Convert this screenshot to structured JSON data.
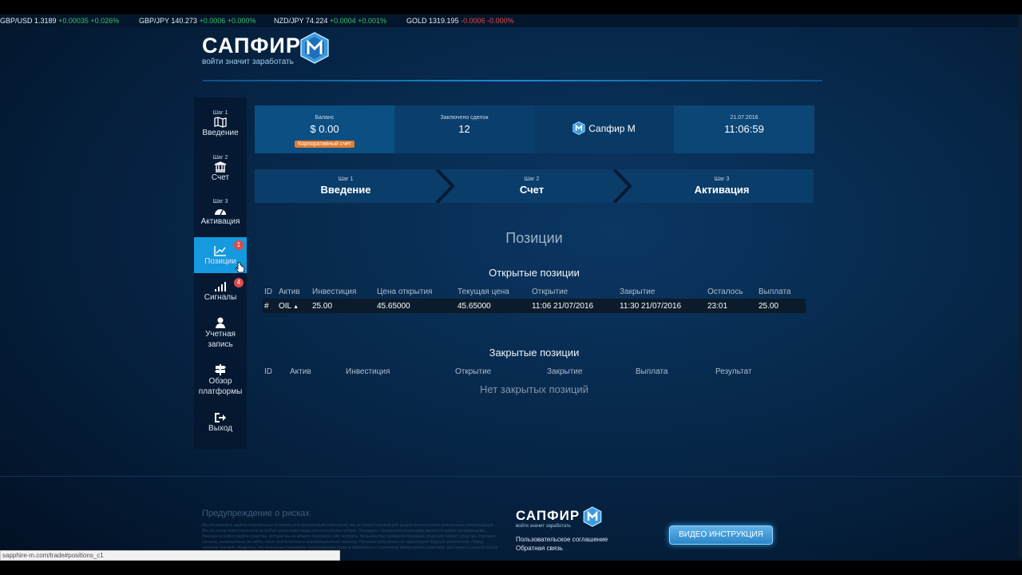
{
  "ticker": [
    {
      "symbol": "GBP/USD",
      "price": "1.3189",
      "change": "+0.00035",
      "pct": "+0.026%",
      "dir": "up"
    },
    {
      "symbol": "GBP/JPY",
      "price": "140.273",
      "change": "+0.0006",
      "pct": "+0.000%",
      "dir": "up"
    },
    {
      "symbol": "NZD/JPY",
      "price": "74.224",
      "change": "+0.0004",
      "pct": "+0.001%",
      "dir": "up"
    },
    {
      "symbol": "GOLD",
      "price": "1319.195",
      "change": "-0.0006",
      "pct": "-0.000%",
      "dir": "down"
    }
  ],
  "logo": {
    "word": "САПФИР",
    "tagline": "войти значит заработать"
  },
  "sidebar": {
    "items": [
      {
        "step": "Шаг 1",
        "label": "Введение",
        "icon": "map-icon"
      },
      {
        "step": "Шаг 2",
        "label": "Счет",
        "icon": "bank-icon"
      },
      {
        "step": "Шаг 3",
        "label": "Активация",
        "icon": "gauge-icon"
      },
      {
        "label": "Позиции",
        "icon": "chart-icon",
        "badge": "1"
      },
      {
        "label": "Сигналы",
        "icon": "signal-icon",
        "badge": "4"
      },
      {
        "label": "Учетная запись",
        "icon": "user-icon"
      },
      {
        "label": "Обзор платформы",
        "icon": "signpost-icon"
      },
      {
        "label": "Выход",
        "icon": "logout-icon"
      }
    ]
  },
  "stats": {
    "balance_label": "Баланс",
    "balance_value": "$ 0.00",
    "account_type": "Корпоративный счет",
    "deals_label": "Заключено сделок",
    "deals_value": "12",
    "brand": "Сапфир М",
    "date": "21.07.2016",
    "time": "11:06:59"
  },
  "steps": [
    {
      "step": "Шаг 1",
      "name": "Введение"
    },
    {
      "step": "Шаг 2",
      "name": "Счет"
    },
    {
      "step": "Шаг 3",
      "name": "Активация"
    }
  ],
  "positions": {
    "title": "Позиции",
    "open_title": "Открытые позиции",
    "open_headers": [
      "ID",
      "Актив",
      "Инвестиция",
      "Цена открытия",
      "Текущая цена",
      "Открытие",
      "Закрытие",
      "Осталось",
      "Выплата"
    ],
    "open_rows": [
      [
        "#",
        "OIL",
        "25.00",
        "45.65000",
        "45.65000",
        "11:06 21/07/2016",
        "11:30 21/07/2016",
        "23:01",
        "25.00"
      ]
    ],
    "closed_title": "Закрытые позиции",
    "closed_headers": [
      "ID",
      "Актив",
      "Инвестиция",
      "Открытие",
      "Закрытие",
      "Выплата",
      "Результат"
    ],
    "closed_empty": "Нет закрытых позиций"
  },
  "footer": {
    "risk_title": "Предупреждение о рисках",
    "risk_text": "Мы не являемся зарегистрированным брокером или финансовым советником, мы не предоставляем для вашего рассмотрения финансовых рекомендаций. Мы не несем ответственности за любые ваши инвестиции или понесенные потери. Операции с бинарными опционами являются крайне рискованными. Никогда не инвестируйте средства, которые вы не можете позволить себе потерять. Большинство трейдеров бинарных опционов теряют средства. Торговые сигналы, размещенные на сайте, носят исключительно информационный характер. Прошлые результаты не гарантируют будущих результатов. Перед началом торговли убедитесь, что полностью понимаете сопутствующие риски и обратитесь к стороннему финансовому советнику. Доступность данной услуги может быть ограничена.",
    "logo_word": "САПФИР",
    "logo_tagline": "войти значит заработать",
    "agreement": "Пользовательское соглашение",
    "feedback": "Обратная связь",
    "video_button": "ВИДЕО ИНСТРУКЦИЯ"
  },
  "statusbar_url": "sapphire-m.com/trade#positions_c1",
  "colors": {
    "accent": "#1599df",
    "up": "#39c46b",
    "down": "#e5484d",
    "badge": "#e04848",
    "account_badge": "#e07b2e"
  }
}
